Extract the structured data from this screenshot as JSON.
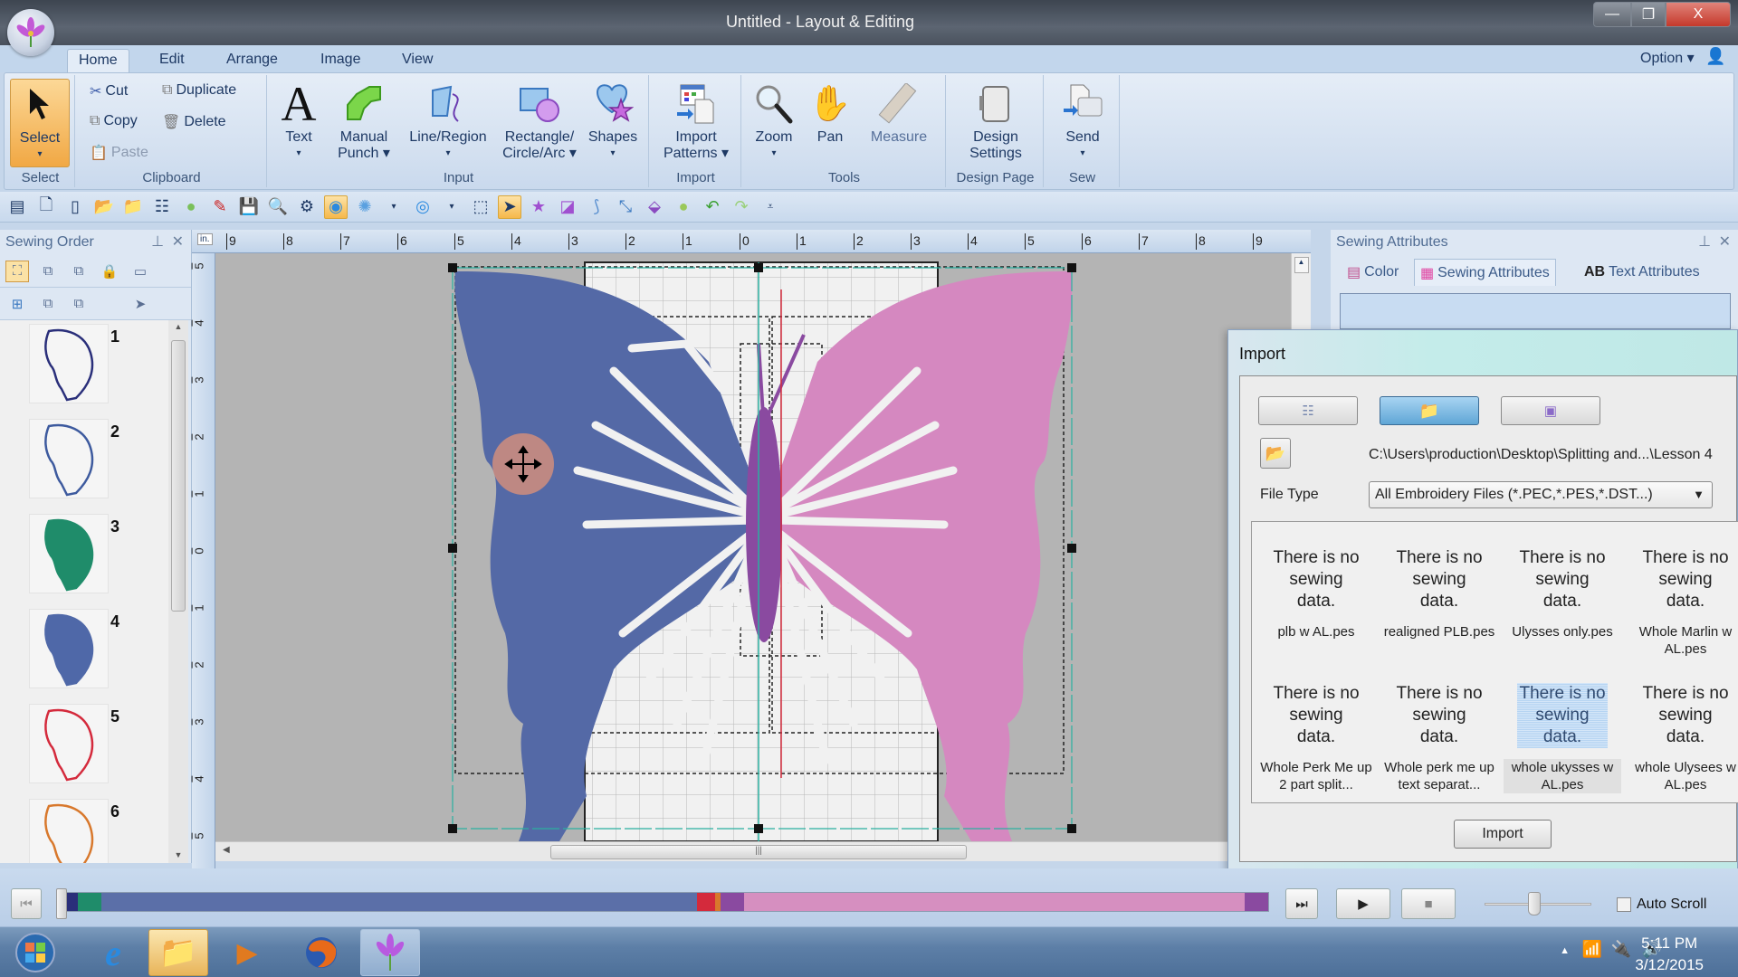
{
  "window": {
    "title": "Untitled - Layout & Editing",
    "controls": {
      "minimize": "—",
      "restore": "❐",
      "close": "X"
    }
  },
  "menu_tabs": [
    {
      "label": "Home",
      "active": true
    },
    {
      "label": "Edit",
      "active": false
    },
    {
      "label": "Arrange",
      "active": false
    },
    {
      "label": "Image",
      "active": false
    },
    {
      "label": "View",
      "active": false
    }
  ],
  "option_label": "Option",
  "ribbon": {
    "select_group": {
      "button": "Select",
      "label": "Select"
    },
    "clipboard_group": {
      "label": "Clipboard",
      "cut": "Cut",
      "copy": "Copy",
      "paste": "Paste",
      "duplicate": "Duplicate",
      "delete": "Delete"
    },
    "input_group": {
      "label": "Input",
      "text": "Text",
      "manual_punch_1": "Manual",
      "manual_punch_2": "Punch",
      "line_region": "Line/Region",
      "rect_1": "Rectangle/",
      "rect_2": "Circle/Arc",
      "shapes": "Shapes"
    },
    "import_group": {
      "label": "Import",
      "btn_1": "Import",
      "btn_2": "Patterns"
    },
    "tools_group": {
      "label": "Tools",
      "zoom": "Zoom",
      "pan": "Pan",
      "measure": "Measure"
    },
    "design_page_group": {
      "label": "Design Page",
      "btn_1": "Design",
      "btn_2": "Settings"
    },
    "sew_group": {
      "label": "Sew",
      "send": "Send"
    }
  },
  "sewing_order": {
    "title": "Sewing Order",
    "items": [
      {
        "num": "1",
        "color": "#2a2f7a",
        "fill": false
      },
      {
        "num": "2",
        "color": "#3d5a9e",
        "fill": false
      },
      {
        "num": "3",
        "color": "#1f8c6a",
        "fill": true
      },
      {
        "num": "4",
        "color": "#4f68a8",
        "fill": true
      },
      {
        "num": "5",
        "color": "#d42a3c",
        "fill": false
      },
      {
        "num": "6",
        "color": "#d8782c",
        "fill": false
      }
    ]
  },
  "ruler": {
    "unit": "in.",
    "top_ticks": [
      "9",
      "8",
      "7",
      "6",
      "5",
      "4",
      "3",
      "2",
      "1",
      "0",
      "1",
      "2",
      "3",
      "4",
      "5",
      "6",
      "7",
      "8",
      "9"
    ],
    "left_ticks": [
      "5",
      "4",
      "3",
      "2",
      "1",
      "0",
      "1",
      "2",
      "3",
      "4",
      "5"
    ]
  },
  "sewing_attributes": {
    "title": "Sewing Attributes",
    "tabs": [
      {
        "label": "Color",
        "active": false
      },
      {
        "label": "Sewing Attributes",
        "active": true
      },
      {
        "label": "Text Attributes",
        "active": false
      }
    ]
  },
  "import_dialog": {
    "title": "Import",
    "path": "C:\\Users\\production\\Desktop\\Splitting and...\\Lesson 4",
    "file_type_label": "File Type",
    "file_type_value": "All Embroidery Files (*.PEC,*.PES,*.DST...)",
    "no_data_msg": "There is no sewing data.",
    "files": [
      {
        "name": "plb w AL.pes",
        "selected": false
      },
      {
        "name": "realigned PLB.pes",
        "selected": false
      },
      {
        "name": "Ulysses only.pes",
        "selected": false
      },
      {
        "name": "Whole Marlin w AL.pes",
        "selected": false
      },
      {
        "name": "Whole Perk Me up 2 part split...",
        "selected": false
      },
      {
        "name": "Whole perk me up text separat...",
        "selected": false
      },
      {
        "name": "whole ukysses w AL.pes",
        "selected": true
      },
      {
        "name": "whole Ulysees w AL.pes",
        "selected": false
      }
    ],
    "import_button": "Import"
  },
  "player": {
    "auto_scroll_label": "Auto Scroll",
    "auto_scroll_checked": false,
    "speed_fraction": 0.47,
    "color_segments": [
      {
        "color": "#2a2f7a",
        "weight": 1
      },
      {
        "color": "#1f8c6a",
        "weight": 2
      },
      {
        "color": "#5b6fa8",
        "weight": 50
      },
      {
        "color": "#d42a3c",
        "weight": 1.5
      },
      {
        "color": "#d8782c",
        "weight": 0.5
      },
      {
        "color": "#8a4aa0",
        "weight": 2
      },
      {
        "color": "#d68fc0",
        "weight": 42
      },
      {
        "color": "#8a4aa0",
        "weight": 2
      }
    ]
  },
  "taskbar": {
    "time": "5:11 PM",
    "date": "3/12/2015"
  },
  "design": {
    "wing_left_color": "#5469a6",
    "wing_right_color": "#d588c0",
    "body_color": "#8a4aa0"
  }
}
